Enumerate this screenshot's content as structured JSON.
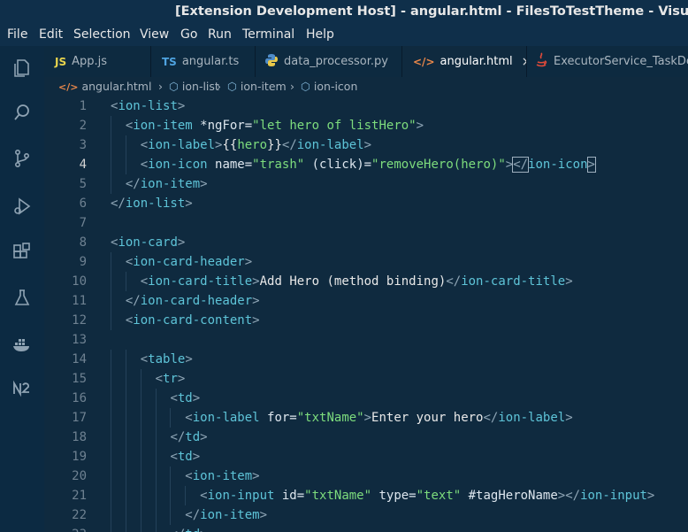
{
  "window": {
    "title": "[Extension Development Host] - angular.html - FilesToTestTheme - Visual Studio C"
  },
  "menu": [
    "File",
    "Edit",
    "Selection",
    "View",
    "Go",
    "Run",
    "Terminal",
    "Help"
  ],
  "activity_icons": [
    "explorer-icon",
    "search-icon",
    "source-control-icon",
    "run-debug-icon",
    "extensions-icon",
    "testing-icon",
    "docker-icon",
    "nx-console-icon"
  ],
  "tabs": [
    {
      "icon": "JS",
      "label": "App.js",
      "icon_color": "#e8d44d"
    },
    {
      "icon": "TS",
      "label": "angular.ts",
      "icon_color": "#4fa3e0"
    },
    {
      "icon": "py",
      "label": "data_processor.py",
      "icon_color": "#4f8cc9"
    },
    {
      "icon": "</>",
      "label": "angular.html",
      "icon_color": "#e8874a",
      "active": true,
      "close": "×"
    },
    {
      "icon": "java",
      "label": "ExecutorService_TaskDep",
      "icon_color": "#e04a3a"
    }
  ],
  "breadcrumb": [
    {
      "icon": "</>",
      "label": "angular.html"
    },
    {
      "icon": "⬡",
      "label": "ion-list"
    },
    {
      "icon": "⬡",
      "label": "ion-item"
    },
    {
      "icon": "⬡",
      "label": "ion-icon"
    }
  ],
  "editor": {
    "current_line": 4,
    "lines": [
      {
        "n": "1",
        "indent": 0,
        "tokens": [
          [
            "p",
            "<"
          ],
          [
            "t",
            "ion-list"
          ],
          [
            "p",
            ">"
          ]
        ]
      },
      {
        "n": "2",
        "indent": 1,
        "tokens": [
          [
            "p",
            "<"
          ],
          [
            "t",
            "ion-item"
          ],
          [
            "a",
            " *ngFor="
          ],
          [
            "s",
            "\"let hero of listHero\""
          ],
          [
            "p",
            ">"
          ]
        ]
      },
      {
        "n": "3",
        "indent": 2,
        "tokens": [
          [
            "p",
            "<"
          ],
          [
            "t",
            "ion-label"
          ],
          [
            "p",
            ">"
          ],
          [
            "x",
            "{{"
          ],
          [
            "s",
            "hero"
          ],
          [
            "x",
            "}}"
          ],
          [
            "p",
            "</"
          ],
          [
            "t",
            "ion-label"
          ],
          [
            "p",
            ">"
          ]
        ]
      },
      {
        "n": "4",
        "indent": 2,
        "tokens": [
          [
            "p",
            "<"
          ],
          [
            "t",
            "ion-icon"
          ],
          [
            "a",
            " name="
          ],
          [
            "s",
            "\"trash\""
          ],
          [
            "a",
            " (click)="
          ],
          [
            "s",
            "\"removeHero(hero)\""
          ],
          [
            "p",
            ">"
          ],
          [
            "p",
            "</"
          ],
          [
            "t",
            "ion-icon"
          ],
          [
            "p",
            ">"
          ]
        ]
      },
      {
        "n": "5",
        "indent": 1,
        "tokens": [
          [
            "p",
            "</"
          ],
          [
            "t",
            "ion-item"
          ],
          [
            "p",
            ">"
          ]
        ]
      },
      {
        "n": "6",
        "indent": 0,
        "tokens": [
          [
            "p",
            "</"
          ],
          [
            "t",
            "ion-list"
          ],
          [
            "p",
            ">"
          ]
        ]
      },
      {
        "n": "7",
        "indent": 0,
        "tokens": []
      },
      {
        "n": "8",
        "indent": 0,
        "tokens": [
          [
            "p",
            "<"
          ],
          [
            "t",
            "ion-card"
          ],
          [
            "p",
            ">"
          ]
        ]
      },
      {
        "n": "9",
        "indent": 1,
        "tokens": [
          [
            "p",
            "<"
          ],
          [
            "t",
            "ion-card-header"
          ],
          [
            "p",
            ">"
          ]
        ]
      },
      {
        "n": "10",
        "indent": 2,
        "tokens": [
          [
            "p",
            "<"
          ],
          [
            "t",
            "ion-card-title"
          ],
          [
            "p",
            ">"
          ],
          [
            "x",
            "Add Hero (method binding)"
          ],
          [
            "p",
            "</"
          ],
          [
            "t",
            "ion-card-title"
          ],
          [
            "p",
            ">"
          ]
        ]
      },
      {
        "n": "11",
        "indent": 1,
        "tokens": [
          [
            "p",
            "</"
          ],
          [
            "t",
            "ion-card-header"
          ],
          [
            "p",
            ">"
          ]
        ]
      },
      {
        "n": "12",
        "indent": 1,
        "tokens": [
          [
            "p",
            "<"
          ],
          [
            "t",
            "ion-card-content"
          ],
          [
            "p",
            ">"
          ]
        ]
      },
      {
        "n": "13",
        "indent": 0,
        "tokens": []
      },
      {
        "n": "14",
        "indent": 2,
        "tokens": [
          [
            "p",
            "<"
          ],
          [
            "t",
            "table"
          ],
          [
            "p",
            ">"
          ]
        ]
      },
      {
        "n": "15",
        "indent": 3,
        "tokens": [
          [
            "p",
            "<"
          ],
          [
            "t",
            "tr"
          ],
          [
            "p",
            ">"
          ]
        ]
      },
      {
        "n": "16",
        "indent": 4,
        "tokens": [
          [
            "p",
            "<"
          ],
          [
            "t",
            "td"
          ],
          [
            "p",
            ">"
          ]
        ]
      },
      {
        "n": "17",
        "indent": 5,
        "tokens": [
          [
            "p",
            "<"
          ],
          [
            "t",
            "ion-label"
          ],
          [
            "a",
            " for="
          ],
          [
            "s",
            "\"txtName\""
          ],
          [
            "p",
            ">"
          ],
          [
            "x",
            "Enter your hero"
          ],
          [
            "p",
            "</"
          ],
          [
            "t",
            "ion-label"
          ],
          [
            "p",
            ">"
          ]
        ]
      },
      {
        "n": "18",
        "indent": 4,
        "tokens": [
          [
            "p",
            "</"
          ],
          [
            "t",
            "td"
          ],
          [
            "p",
            ">"
          ]
        ]
      },
      {
        "n": "19",
        "indent": 4,
        "tokens": [
          [
            "p",
            "<"
          ],
          [
            "t",
            "td"
          ],
          [
            "p",
            ">"
          ]
        ]
      },
      {
        "n": "20",
        "indent": 5,
        "tokens": [
          [
            "p",
            "<"
          ],
          [
            "t",
            "ion-item"
          ],
          [
            "p",
            ">"
          ]
        ]
      },
      {
        "n": "21",
        "indent": 6,
        "tokens": [
          [
            "p",
            "<"
          ],
          [
            "t",
            "ion-input"
          ],
          [
            "a",
            " id="
          ],
          [
            "s",
            "\"txtName\""
          ],
          [
            "a",
            " type="
          ],
          [
            "s",
            "\"text\""
          ],
          [
            "a",
            " #tagHeroName"
          ],
          [
            "p",
            ">"
          ],
          [
            "p",
            "</"
          ],
          [
            "t",
            "ion-input"
          ],
          [
            "p",
            ">"
          ]
        ]
      },
      {
        "n": "22",
        "indent": 5,
        "tokens": [
          [
            "p",
            "</"
          ],
          [
            "t",
            "ion-item"
          ],
          [
            "p",
            ">"
          ]
        ]
      },
      {
        "n": "23",
        "indent": 4,
        "tokens": [
          [
            "p",
            "</"
          ],
          [
            "t",
            "td"
          ],
          [
            "p",
            ">"
          ]
        ]
      }
    ]
  }
}
